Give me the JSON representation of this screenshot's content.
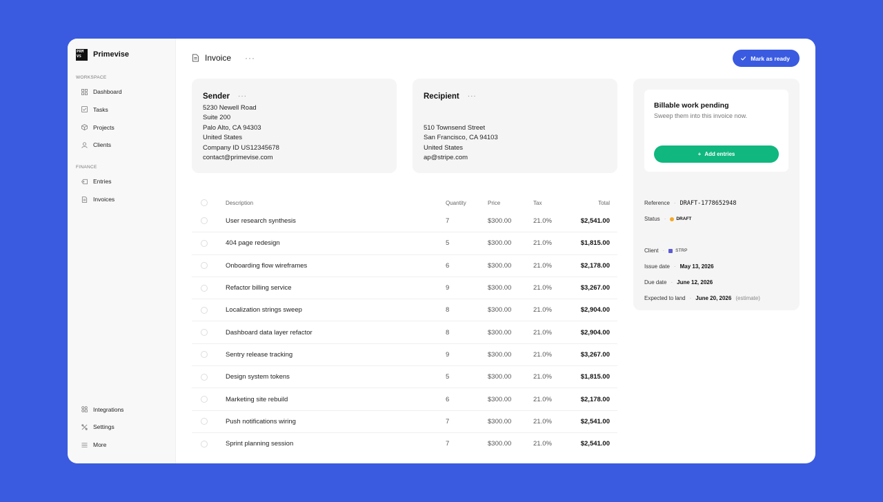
{
  "brand": {
    "logo_text": "PRM VS",
    "name": "Primevise"
  },
  "sidebar": {
    "workspace_label": "WORKSPACE",
    "workspace_items": [
      {
        "label": "Dashboard",
        "icon": "grid-icon"
      },
      {
        "label": "Tasks",
        "icon": "checkbox-icon"
      },
      {
        "label": "Projects",
        "icon": "cube-icon"
      },
      {
        "label": "Clients",
        "icon": "user-icon"
      }
    ],
    "finance_label": "FINANCE",
    "finance_items": [
      {
        "label": "Entries",
        "icon": "tag-icon"
      },
      {
        "label": "Invoices",
        "icon": "document-icon"
      }
    ],
    "bottom_items": [
      {
        "label": "Integrations",
        "icon": "apps-icon"
      },
      {
        "label": "Settings",
        "icon": "settings-icon"
      },
      {
        "label": "More",
        "icon": "menu-icon"
      }
    ]
  },
  "header": {
    "title": "Invoice",
    "more": "···",
    "mark_ready_label": "Mark as ready"
  },
  "sender": {
    "title": "Sender",
    "lines": [
      "5230 Newell Road",
      "Suite 200",
      "Palo Alto, CA 94303",
      "United States",
      "Company ID US12345678",
      "contact@primevise.com"
    ]
  },
  "recipient": {
    "title": "Recipient",
    "lines": [
      "510 Townsend Street",
      "San Francisco, CA 94103",
      "United States",
      "ap@stripe.com"
    ]
  },
  "table": {
    "columns": {
      "description": "Description",
      "quantity": "Quantity",
      "price": "Price",
      "tax": "Tax",
      "total": "Total"
    },
    "rows": [
      {
        "description": "User research synthesis",
        "quantity": "7",
        "price": "$300.00",
        "tax": "21.0%",
        "total": "$2,541.00"
      },
      {
        "description": "404 page redesign",
        "quantity": "5",
        "price": "$300.00",
        "tax": "21.0%",
        "total": "$1,815.00"
      },
      {
        "description": "Onboarding flow wireframes",
        "quantity": "6",
        "price": "$300.00",
        "tax": "21.0%",
        "total": "$2,178.00"
      },
      {
        "description": "Refactor billing service",
        "quantity": "9",
        "price": "$300.00",
        "tax": "21.0%",
        "total": "$3,267.00"
      },
      {
        "description": "Localization strings sweep",
        "quantity": "8",
        "price": "$300.00",
        "tax": "21.0%",
        "total": "$2,904.00"
      },
      {
        "description": "Dashboard data layer refactor",
        "quantity": "8",
        "price": "$300.00",
        "tax": "21.0%",
        "total": "$2,904.00"
      },
      {
        "description": "Sentry release tracking",
        "quantity": "9",
        "price": "$300.00",
        "tax": "21.0%",
        "total": "$3,267.00"
      },
      {
        "description": "Design system tokens",
        "quantity": "5",
        "price": "$300.00",
        "tax": "21.0%",
        "total": "$1,815.00"
      },
      {
        "description": "Marketing site rebuild",
        "quantity": "6",
        "price": "$300.00",
        "tax": "21.0%",
        "total": "$2,178.00"
      },
      {
        "description": "Push notifications wiring",
        "quantity": "7",
        "price": "$300.00",
        "tax": "21.0%",
        "total": "$2,541.00"
      },
      {
        "description": "Sprint planning session",
        "quantity": "7",
        "price": "$300.00",
        "tax": "21.0%",
        "total": "$2,541.00"
      }
    ]
  },
  "panel": {
    "pending_title": "Billable work pending",
    "pending_subtitle": "Sweep them into this invoice now.",
    "add_entries_label": "Add entries",
    "reference_label": "Reference",
    "reference_value": "DRAFT-1778652948",
    "status_label": "Status",
    "status_value": "DRAFT",
    "client_label": "Client",
    "client_value": "STRP",
    "issue_date_label": "Issue date",
    "issue_date_value": "May 13, 2026",
    "due_date_label": "Due date",
    "due_date_value": "June 12, 2026",
    "expected_label": "Expected to land",
    "expected_value": "June 20, 2026",
    "expected_note": "(estimate)",
    "separator": "·"
  },
  "colors": {
    "background": "#3a5be0",
    "accent": "#3a5be0",
    "success": "#10b77f",
    "draft": "#f5a623",
    "client": "#5b5bd6"
  }
}
